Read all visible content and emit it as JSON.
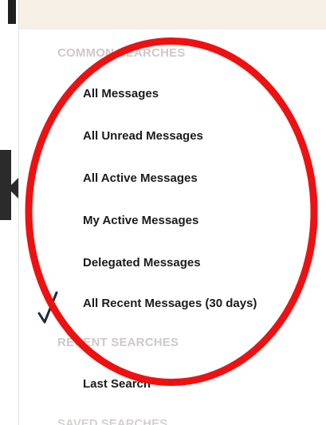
{
  "sections": {
    "common_heading": "COMMON SEARCHES",
    "recent_heading": "RECENT SEARCHES",
    "saved_heading": "SAVED SEARCHES"
  },
  "common_searches": [
    {
      "label": "All Messages",
      "selected": false
    },
    {
      "label": "All Unread Messages",
      "selected": false
    },
    {
      "label": "All Active Messages",
      "selected": false
    },
    {
      "label": "My Active Messages",
      "selected": false
    },
    {
      "label": "Delegated Messages",
      "selected": false
    },
    {
      "label": "All Recent Messages (30 days)",
      "selected": true
    }
  ],
  "recent_searches": [
    {
      "label": "Last Search"
    }
  ],
  "icons": {
    "selected_marker": "check-icon",
    "collapse_tab": "chevron-left-icon"
  },
  "colors": {
    "annotation": "#ee1111",
    "heading": "#cfc8c8",
    "item_text": "#1b1b1b",
    "header_background": "#f5efe6"
  }
}
